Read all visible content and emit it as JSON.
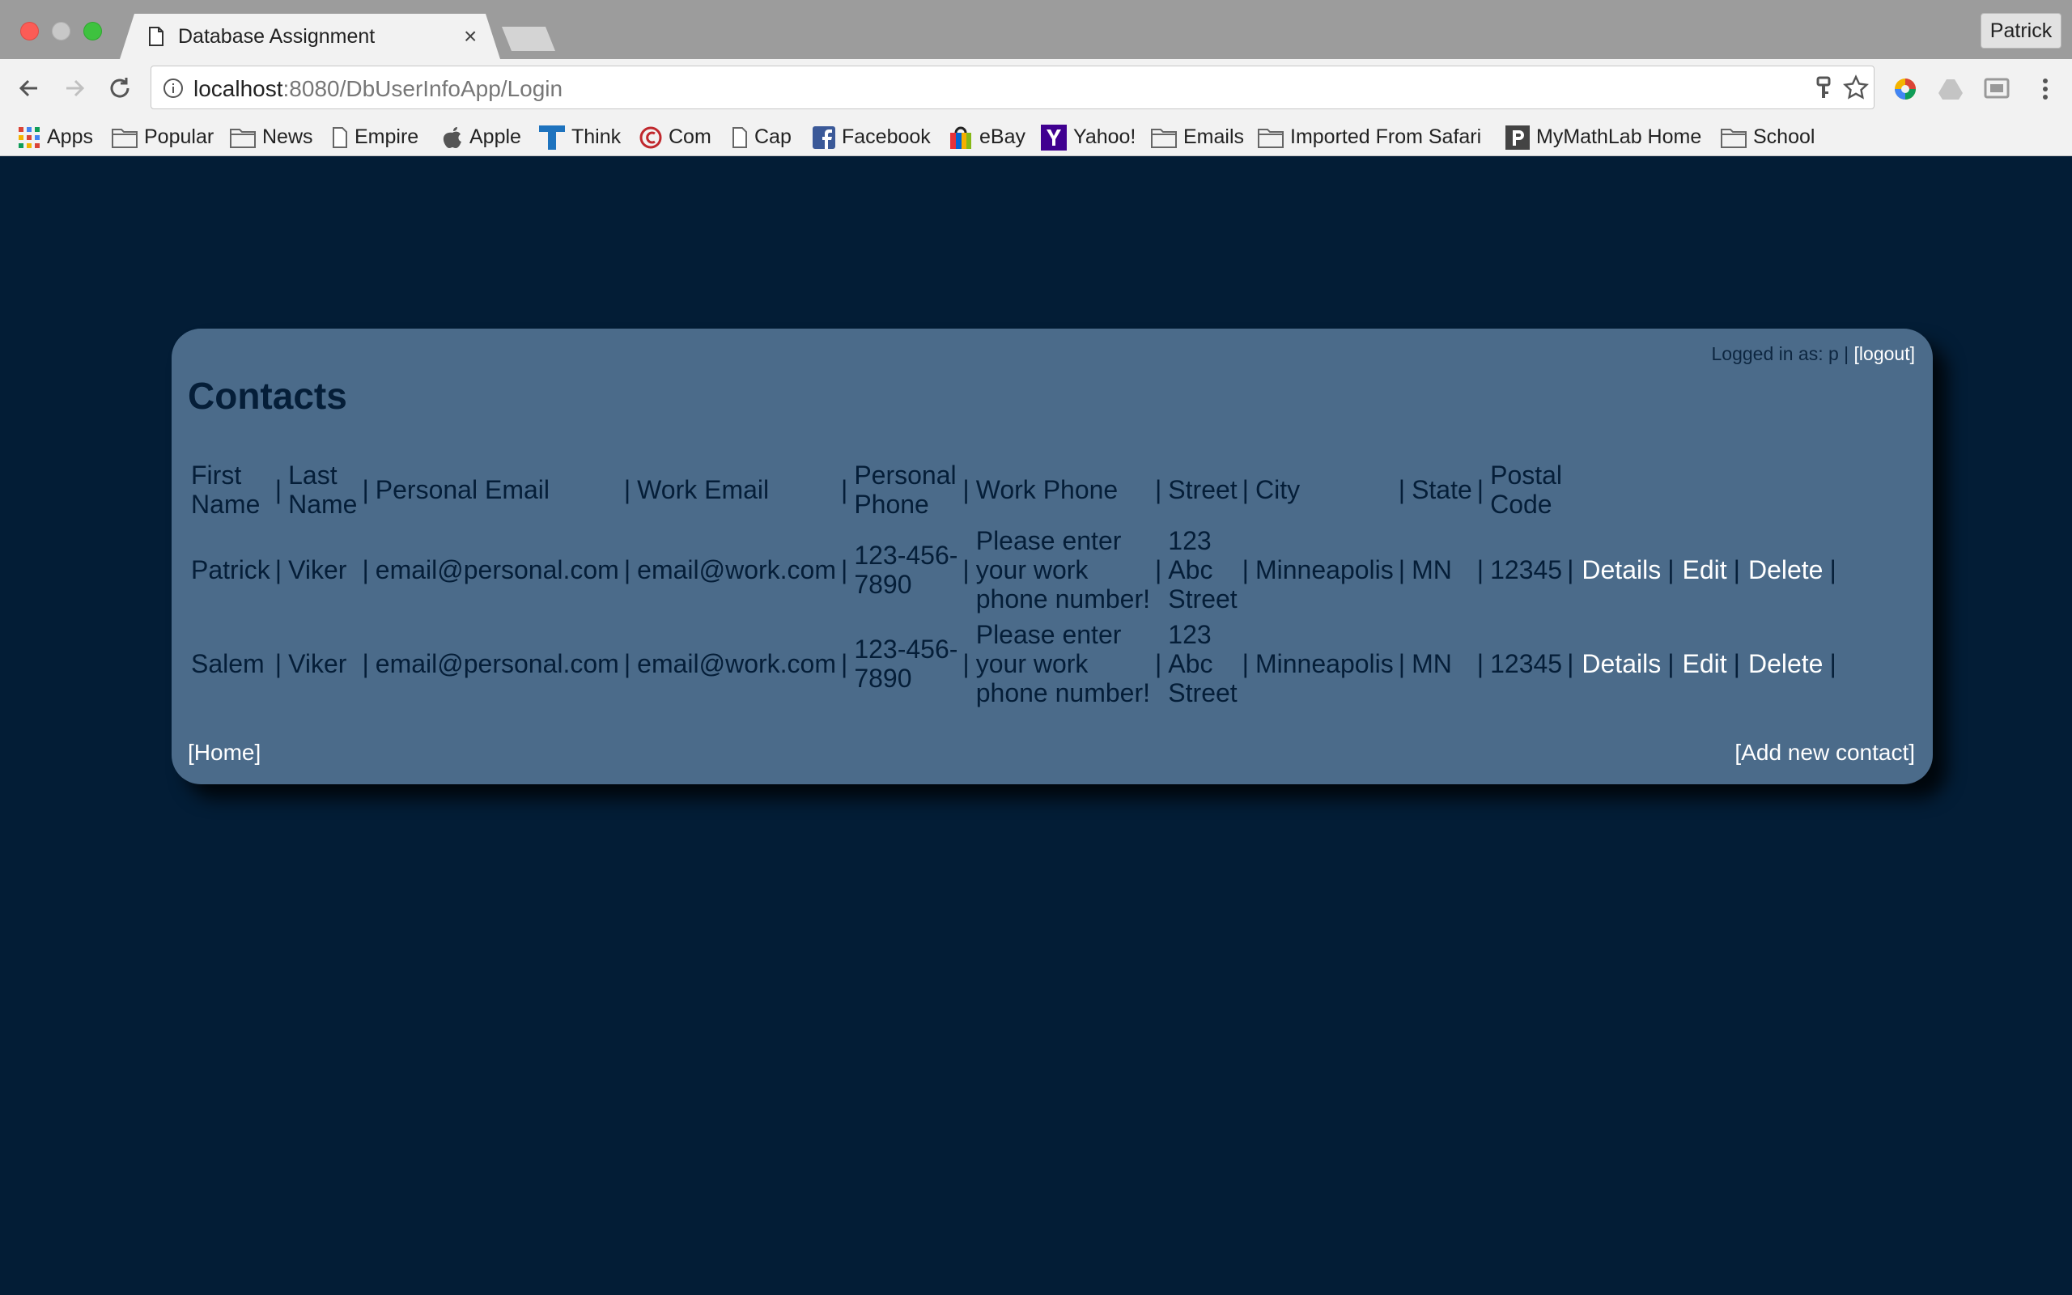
{
  "browser": {
    "tab_title": "Database Assignment",
    "tab_close": "×",
    "profile_name": "Patrick",
    "url_host": "localhost",
    "url_rest": ":8080/DbUserInfoApp/Login"
  },
  "bookmarks": [
    {
      "label": "Apps",
      "icon": "apps-grid-icon"
    },
    {
      "label": "Popular",
      "icon": "folder-icon"
    },
    {
      "label": "News",
      "icon": "folder-icon"
    },
    {
      "label": "Empire",
      "icon": "page-icon"
    },
    {
      "label": "Apple",
      "icon": "apple-icon"
    },
    {
      "label": "Think",
      "icon": "think-icon"
    },
    {
      "label": "Com",
      "icon": "com-icon"
    },
    {
      "label": "Cap",
      "icon": "page-icon"
    },
    {
      "label": "Facebook",
      "icon": "facebook-icon"
    },
    {
      "label": "eBay",
      "icon": "ebay-icon"
    },
    {
      "label": "Yahoo!",
      "icon": "yahoo-icon"
    },
    {
      "label": "Emails",
      "icon": "folder-icon"
    },
    {
      "label": "Imported From Safari",
      "icon": "folder-icon"
    },
    {
      "label": "MyMathLab Home",
      "icon": "mymathlab-icon"
    },
    {
      "label": "School",
      "icon": "folder-icon"
    }
  ],
  "page": {
    "login_prefix": "Logged in as: p | ",
    "logout_label": "[logout]",
    "title": "Contacts",
    "separator": "|",
    "columns": [
      {
        "line1": "First",
        "line2": "Name"
      },
      {
        "line1": "Last",
        "line2": "Name"
      },
      {
        "line1": "Personal Email",
        "line2": ""
      },
      {
        "line1": "Work Email",
        "line2": ""
      },
      {
        "line1": "Personal",
        "line2": "Phone"
      },
      {
        "line1": "Work Phone",
        "line2": ""
      },
      {
        "line1": "Street",
        "line2": ""
      },
      {
        "line1": "City",
        "line2": ""
      },
      {
        "line1": "State",
        "line2": ""
      },
      {
        "line1": "Postal",
        "line2": "Code"
      }
    ],
    "rows": [
      {
        "first_name": "Patrick",
        "last_name": "Viker",
        "personal_email": "email@personal.com",
        "work_email": "email@work.com",
        "personal_phone": [
          "123-456-",
          "7890"
        ],
        "work_phone": [
          "Please enter",
          "your work",
          "phone number!"
        ],
        "street": [
          "123",
          "Abc",
          "Street"
        ],
        "city": "Minneapolis",
        "state": "MN",
        "postal_code": "12345",
        "details_label": "Details",
        "edit_label": "Edit",
        "delete_label": "Delete"
      },
      {
        "first_name": "Salem",
        "last_name": "Viker",
        "personal_email": "email@personal.com",
        "work_email": "email@work.com",
        "personal_phone": [
          "123-456-",
          "7890"
        ],
        "work_phone": [
          "Please enter",
          "your work",
          "phone number!"
        ],
        "street": [
          "123",
          "Abc",
          "Street"
        ],
        "city": "Minneapolis",
        "state": "MN",
        "postal_code": "12345",
        "details_label": "Details",
        "edit_label": "Edit",
        "delete_label": "Delete"
      }
    ],
    "home_label": "[Home]",
    "add_contact_label": "[Add new contact]"
  }
}
